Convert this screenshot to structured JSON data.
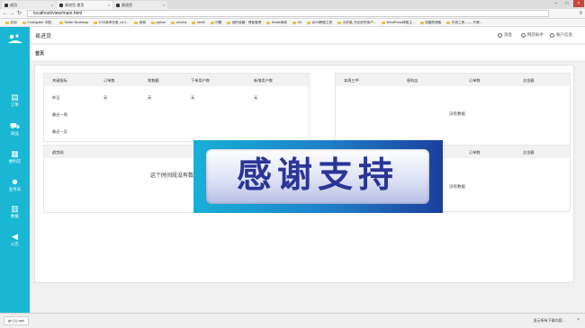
{
  "browser": {
    "tabs": [
      {
        "label": "成功",
        "active": false
      },
      {
        "label": "易进货-首页",
        "active": true
      },
      {
        "label": "易进货",
        "active": false
      }
    ],
    "url": "localhost/view/main.html",
    "bookmarks": [
      "应用",
      "Codeigniter 中国...",
      "Twitter Bootstrap",
      "CSS参考手册_v4.2...",
      "商城",
      "python",
      "zencha",
      "html5",
      "问题",
      "我的收藏：博客管理",
      "Kindle商城",
      "Git",
      "@Git教程之旅",
      "大前端_写出好的用户...",
      "WordPress博客主...",
      "收藏的博客",
      "在线工具 —— 开源..."
    ]
  },
  "app": {
    "title": "易进货",
    "top_links": [
      "消息",
      "网店助手",
      "账户信息"
    ],
    "logo_icon": "logo-icon",
    "sidebar": [
      {
        "label": "订单",
        "icon": "document-icon"
      },
      {
        "label": "商品",
        "icon": "cart-icon"
      },
      {
        "label": "便利店",
        "icon": "store-icon"
      },
      {
        "label": "业务员",
        "icon": "person-icon"
      },
      {
        "label": "数据",
        "icon": "chart-icon"
      },
      {
        "label": "公告",
        "icon": "megaphone-icon"
      }
    ],
    "accent_color": "#19b7d3"
  },
  "page": {
    "breadcrumb": "首页",
    "key_metrics": {
      "headers": [
        "关键指标",
        "订单数",
        "销售额",
        "下单用户数",
        "新增用户数"
      ],
      "rows": [
        [
          "昨日",
          "无",
          "无",
          "无",
          "无"
        ],
        [
          "最近一周",
          "",
          "",
          "",
          ""
        ],
        [
          "最近一月",
          "",
          "",
          "",
          ""
        ]
      ]
    },
    "weekly_top": {
      "headers": [
        "本周三甲",
        "便利店",
        "订单数",
        "总金额"
      ],
      "empty": "没有数据"
    },
    "trend": {
      "header": "趋势图",
      "empty": "这个时间段没有数据"
    },
    "second_table": {
      "headers": [
        "订单数",
        "总金额"
      ],
      "empty": "没有数据"
    }
  },
  "overlay": {
    "text": "感谢支持"
  },
  "downloads": {
    "file": "gh (1).apk",
    "show_all": "显示所有下载内容...",
    "close": "×"
  }
}
